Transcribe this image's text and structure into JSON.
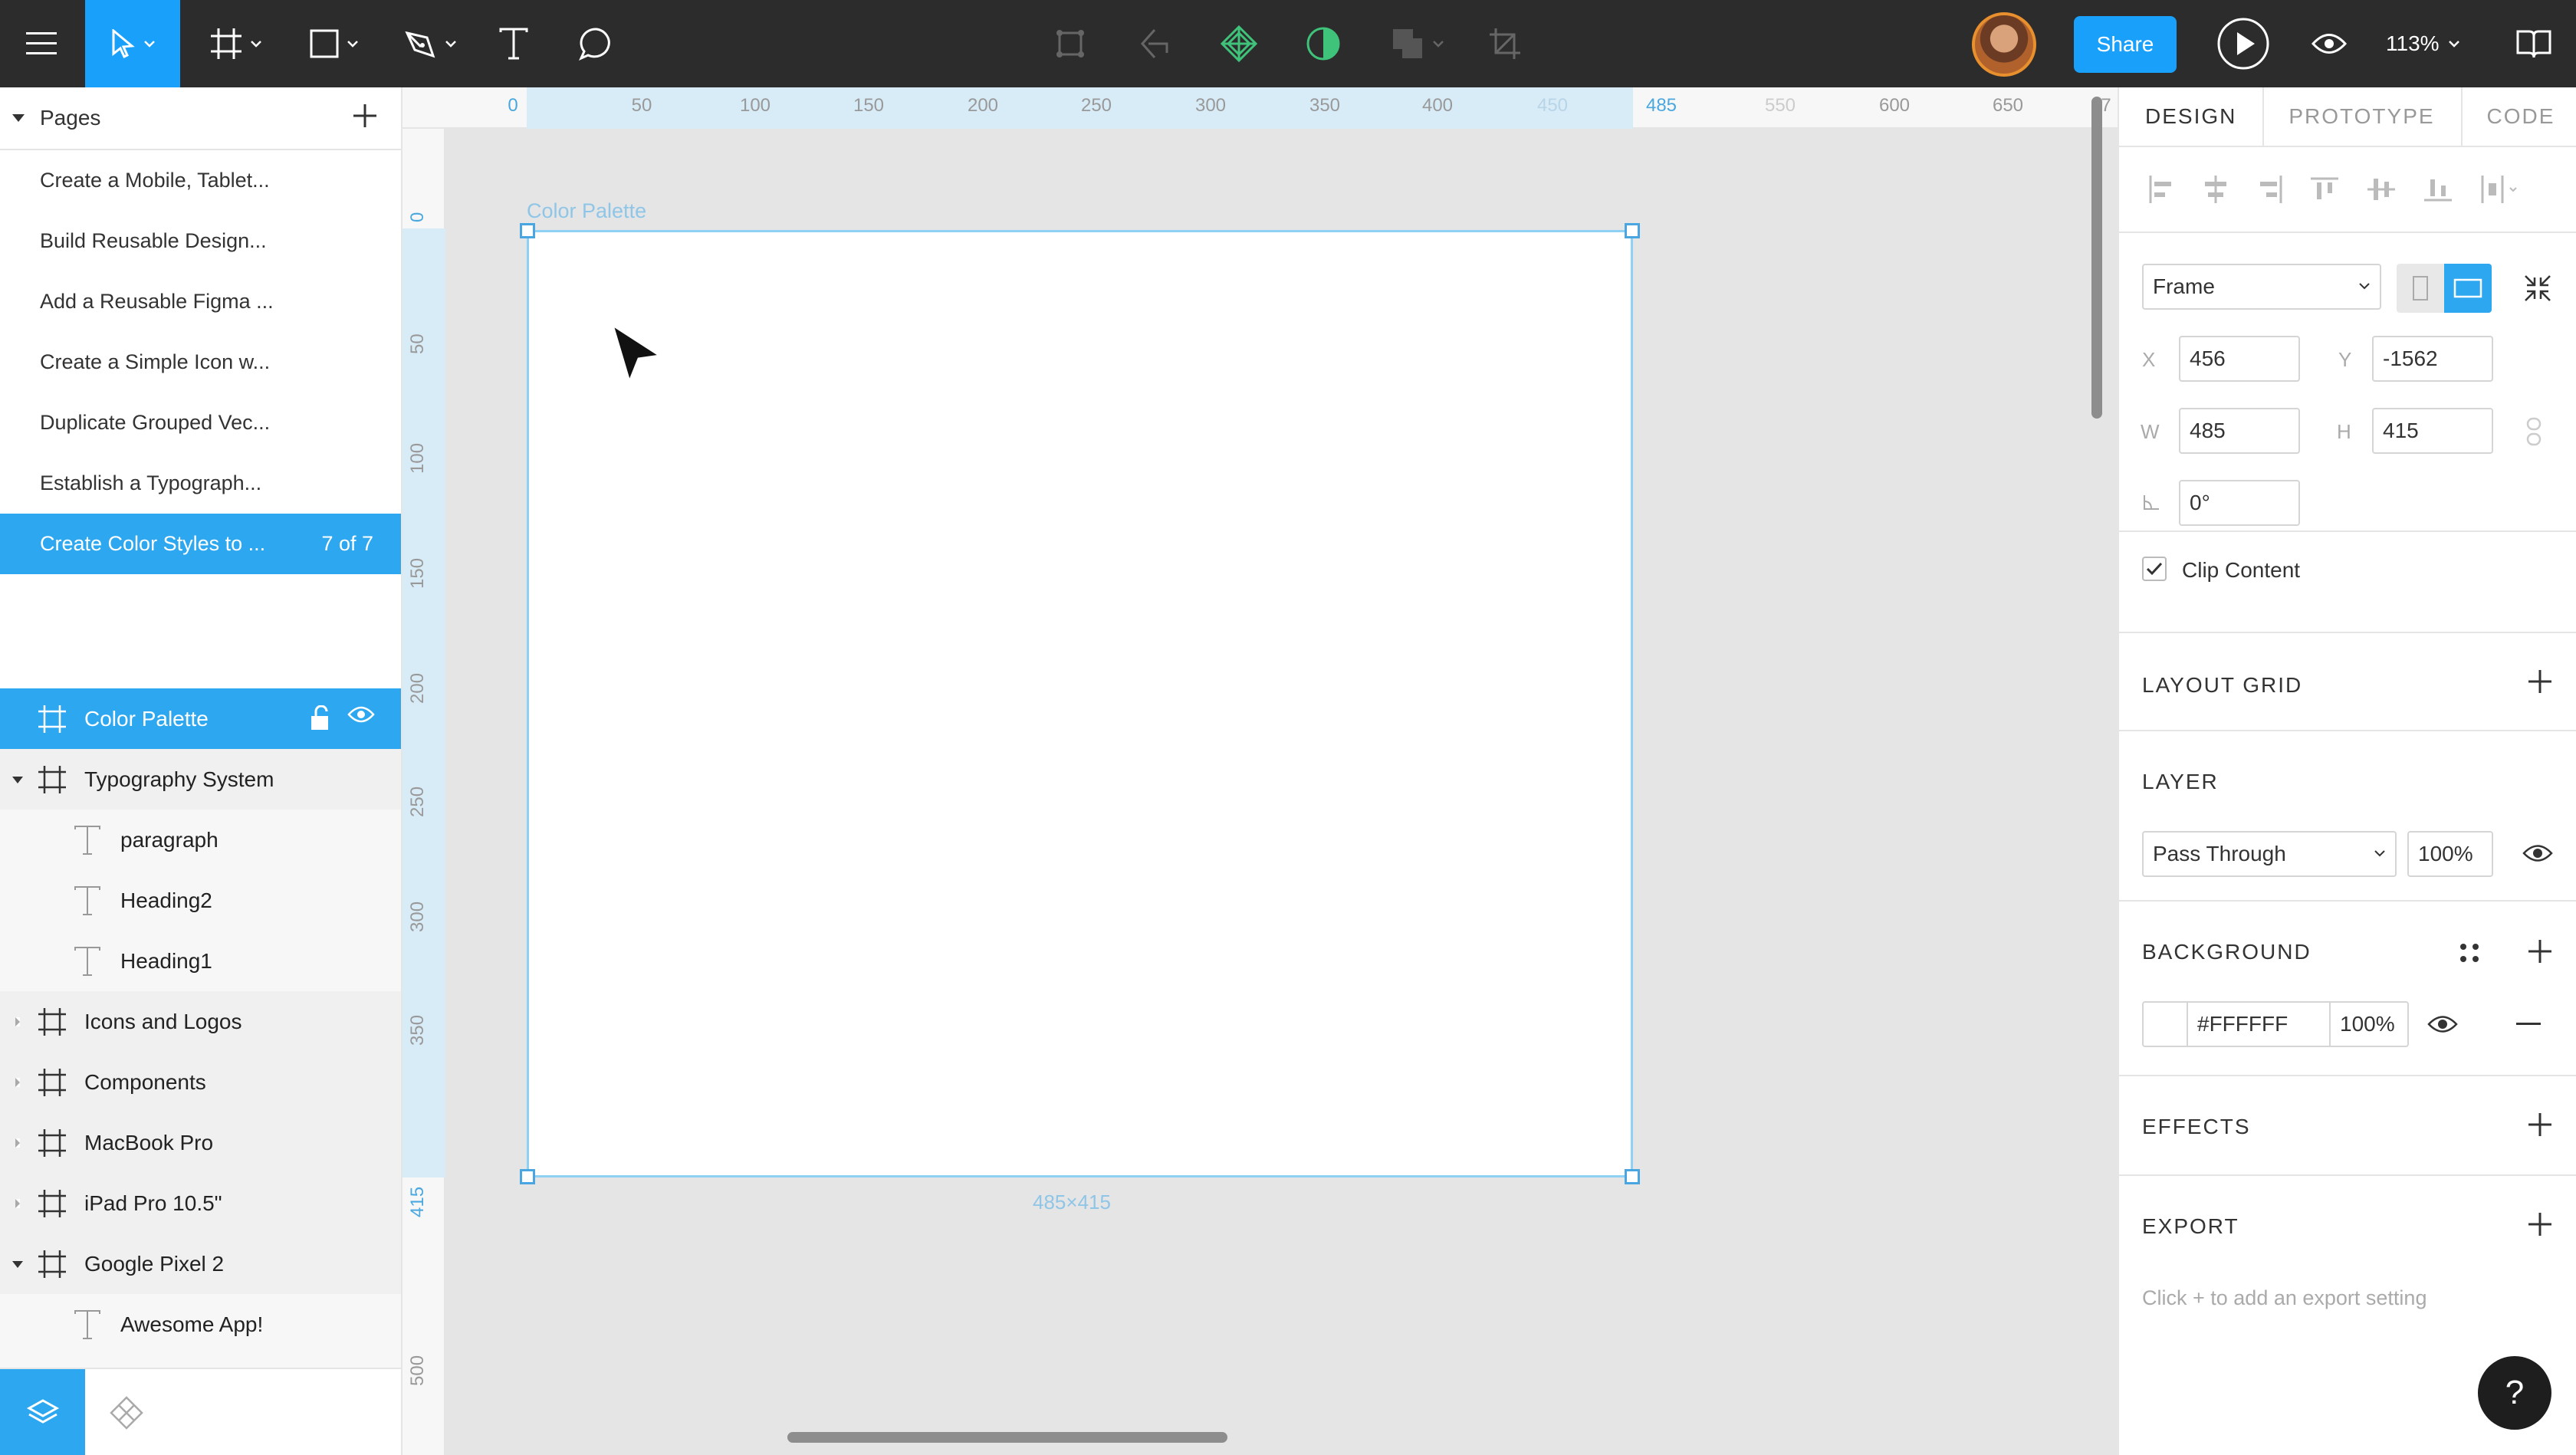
{
  "toolbar": {
    "share_label": "Share",
    "zoom_label": "113%"
  },
  "pages": {
    "header": "Pages",
    "items": [
      {
        "label": "Create a Mobile, Tablet..."
      },
      {
        "label": "Build Reusable Design..."
      },
      {
        "label": "Add a Reusable Figma ..."
      },
      {
        "label": "Create a Simple Icon w..."
      },
      {
        "label": "Duplicate Grouped Vec..."
      },
      {
        "label": "Establish a Typograph..."
      },
      {
        "label": "Create Color Styles to ...",
        "count": "7 of 7"
      }
    ]
  },
  "layers": [
    {
      "label": "Color Palette",
      "type": "frame",
      "active": true
    },
    {
      "label": "Typography System",
      "type": "frame",
      "expanded": true
    },
    {
      "label": "paragraph",
      "type": "text",
      "child": true
    },
    {
      "label": "Heading2",
      "type": "text",
      "child": true
    },
    {
      "label": "Heading1",
      "type": "text",
      "child": true
    },
    {
      "label": "Icons and Logos",
      "type": "frame"
    },
    {
      "label": "Components",
      "type": "frame"
    },
    {
      "label": "MacBook Pro",
      "type": "frame"
    },
    {
      "label": "iPad Pro 10.5\"",
      "type": "frame"
    },
    {
      "label": "Google Pixel 2",
      "type": "frame",
      "expanded": true
    },
    {
      "label": "Awesome App!",
      "type": "text",
      "child": true
    }
  ],
  "ruler_top": {
    "ticks": [
      "0",
      "50",
      "100",
      "150",
      "200",
      "250",
      "300",
      "350",
      "400",
      "450",
      "485",
      "550",
      "600",
      "650",
      "7"
    ]
  },
  "ruler_left": {
    "ticks": [
      "0",
      "50",
      "100",
      "150",
      "200",
      "250",
      "300",
      "350",
      "415",
      "500"
    ]
  },
  "canvas": {
    "frame_name": "Color Palette",
    "frame_size": "485×415"
  },
  "design_panel": {
    "tabs": [
      "DESIGN",
      "PROTOTYPE",
      "CODE"
    ],
    "frame_type": "Frame",
    "x_label": "X",
    "x": "456",
    "y_label": "Y",
    "y": "-1562",
    "w_label": "W",
    "w": "485",
    "h_label": "H",
    "h": "415",
    "rotation": "0°",
    "clip_content": "Clip Content",
    "layout_grid": "LAYOUT GRID",
    "layer_title": "LAYER",
    "blend_mode": "Pass Through",
    "layer_opacity": "100%",
    "background_title": "BACKGROUND",
    "bg_hex": "#FFFFFF",
    "bg_opacity": "100%",
    "effects_title": "EFFECTS",
    "export_title": "EXPORT",
    "export_hint": "Click + to add an export setting"
  },
  "help": {
    "label": "?"
  },
  "colors": {
    "accent": "#18a0fb",
    "selection": "#2da8f0",
    "toolbar_bg": "#2c2c2c",
    "component_icon": "#3fc37a"
  }
}
